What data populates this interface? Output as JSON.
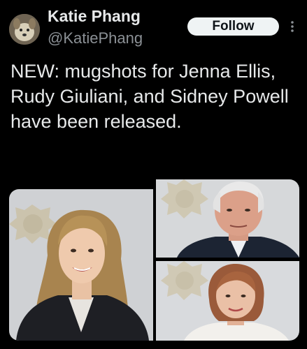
{
  "tweet": {
    "author": {
      "display_name": "Katie Phang",
      "handle": "@KatiePhang",
      "avatar_icon": "dog-avatar"
    },
    "follow_label": "Follow",
    "text": "NEW: mugshots for Jenna Ellis, Rudy Giuliani, and Sidney Powell have been released.",
    "media": [
      {
        "subject": "mugshot-woman-long-blonde-hair"
      },
      {
        "subject": "mugshot-man-white-hair"
      },
      {
        "subject": "mugshot-woman-short-reddish-hair"
      }
    ]
  },
  "colors": {
    "background": "#000000",
    "text": "#e7e9ea",
    "secondary_text": "#8b9095",
    "follow_button_bg": "#eff3f4",
    "mugshot_wall": "#d4d6d9"
  }
}
